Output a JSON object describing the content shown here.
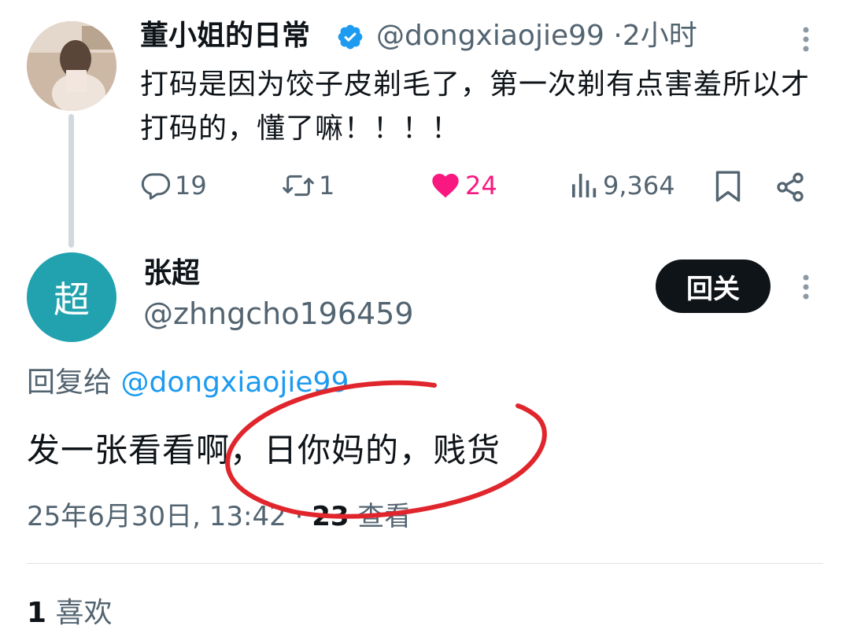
{
  "tweet1": {
    "name": "董小姐的日常",
    "handle": "@dongxiaojie99",
    "separator": "·",
    "time": "2小时",
    "text": "打码是因为饺子皮剃毛了，第一次剃有点害羞所以才打码的，懂了嘛！！！！",
    "actions": {
      "replies": "19",
      "retweets": "1",
      "likes": "24",
      "views": "9,364"
    },
    "like_color": "#f91880",
    "verified_color": "#1d9bf0"
  },
  "tweet2": {
    "avatar_text": "超",
    "avatar_color": "#21a2ae",
    "name": "张超",
    "handle": "@zhngcho196459",
    "follow_label": "回关",
    "reply_to_prefix": "回复给",
    "reply_to_mention": "@dongxiaojie99",
    "text": "发一张看看啊，日你妈的，贱货",
    "date": "25年6月30日, 13:42",
    "views_sep": "·",
    "views_count": "23",
    "views_label": "查看",
    "likes_count": "1",
    "likes_label": "喜欢"
  },
  "annotation_color": "#e0262c",
  "icons": [
    "verified-badge-icon",
    "more-options-icon",
    "reply-icon",
    "retweet-icon",
    "heart-icon",
    "views-icon",
    "bookmark-icon",
    "share-icon"
  ]
}
